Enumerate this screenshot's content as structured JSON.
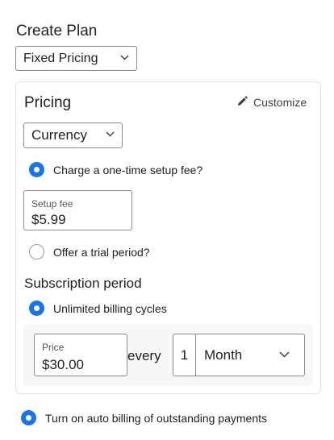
{
  "page": {
    "title": "Create Plan"
  },
  "plan_type": {
    "selected": "Fixed Pricing"
  },
  "pricing": {
    "title": "Pricing",
    "customize_label": "Customize",
    "currency": {
      "selected": "Currency"
    },
    "setup_fee_option": {
      "label": "Charge a one-time setup fee?",
      "checked": true
    },
    "setup_fee": {
      "label": "Setup fee",
      "value": "$5.99"
    },
    "trial_option": {
      "label": "Offer a trial period?",
      "checked": false
    }
  },
  "subscription": {
    "title": "Subscription period",
    "unlimited_option": {
      "label": "Unlimited billing cycles",
      "checked": true
    },
    "price": {
      "label": "Price",
      "value": "$30.00"
    },
    "every_label": "every",
    "interval_count": "1",
    "interval_unit": "Month"
  },
  "auto_billing": {
    "label": "Turn on auto billing of outstanding payments",
    "checked": true
  },
  "colors": {
    "accent": "#1a73e8",
    "border": "#8a8a8a",
    "card_border": "#e3e3e3",
    "panel_bg": "#f7f7f7"
  },
  "icons": {
    "customize": "pencil-icon",
    "dropdown": "chevron-down-icon"
  }
}
